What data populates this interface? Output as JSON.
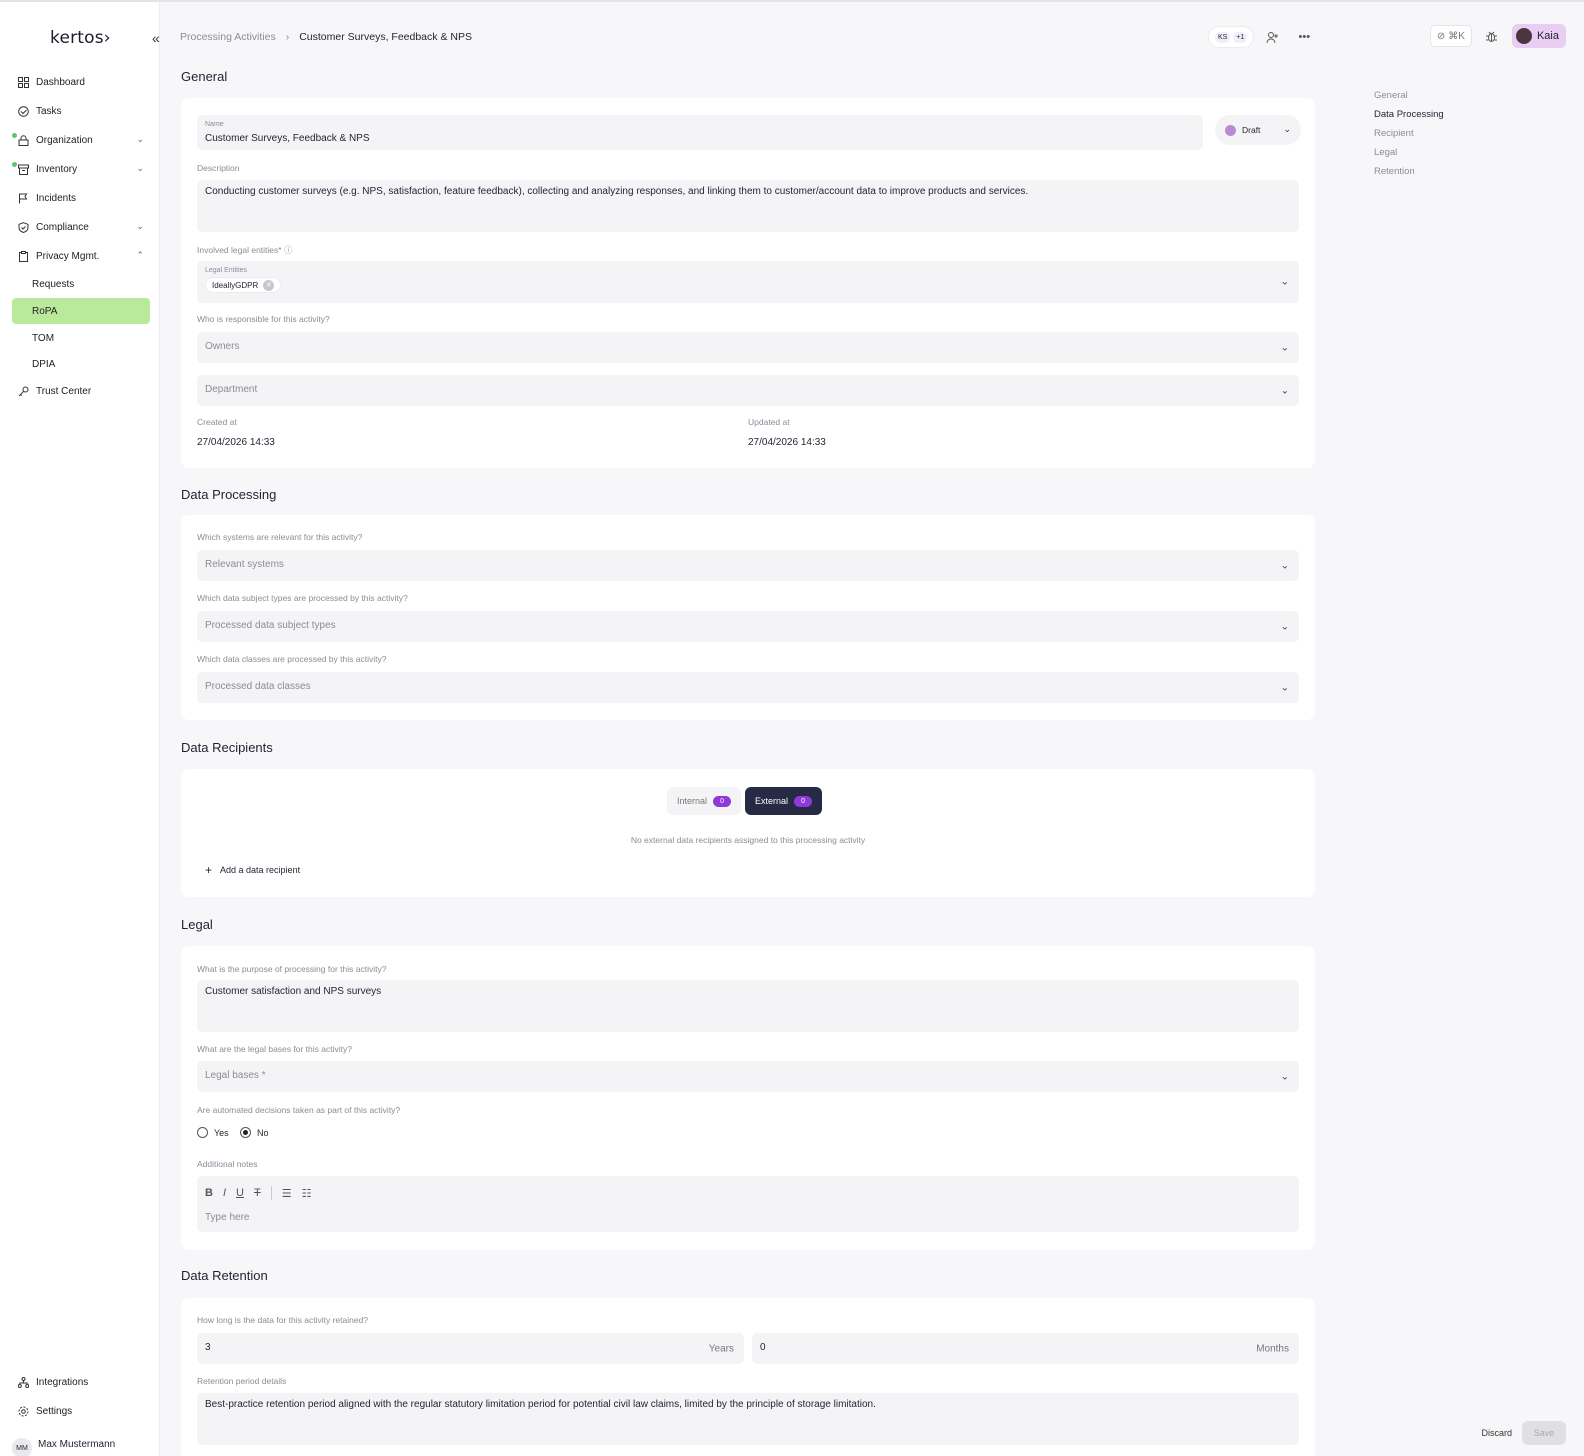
{
  "sidebar": {
    "logo": "kertos›",
    "collapse_icon": "«",
    "items": [
      {
        "label": "Dashboard",
        "icon": "grid-icon"
      },
      {
        "label": "Tasks",
        "icon": "check-circle-icon"
      },
      {
        "label": "Organization",
        "icon": "lock-icon"
      },
      {
        "label": "Inventory",
        "icon": "archive-icon"
      },
      {
        "label": "Incidents",
        "icon": "flag-icon"
      },
      {
        "label": "Compliance",
        "icon": "shield-icon"
      },
      {
        "label": "Privacy Mgmt.",
        "icon": "clipboard-icon"
      }
    ],
    "sub_items": [
      {
        "label": "Requests"
      },
      {
        "label": "RoPA"
      },
      {
        "label": "TOM"
      },
      {
        "label": "DPIA"
      }
    ],
    "trust_center": "Trust Center",
    "bottom": [
      {
        "label": "Integrations"
      },
      {
        "label": "Settings"
      }
    ],
    "user_initials": "MM",
    "user_name": "Max Mustermann",
    "accent": "#b9ea9c"
  },
  "topbar": {
    "breadcrumb_parent": "Processing Activities",
    "breadcrumb_current": "Customer Surveys, Feedback & NPS",
    "user_initials": "KS",
    "user_extra": "+1",
    "shortcut": "⌘K",
    "profile_name": "Kaia"
  },
  "toc": [
    "General",
    "Data Processing",
    "Recipient",
    "Legal",
    "Retention"
  ],
  "general": {
    "title": "General",
    "name_label": "Name",
    "name_value": "Customer Surveys, Feedback & NPS",
    "status": "Draft",
    "description_label": "Description",
    "description_value": "Conducting customer surveys (e.g. NPS, satisfaction, feature feedback), collecting and analyzing responses, and linking them to customer/account data to improve products and services.",
    "legal_entities_question": "Involved legal entities*",
    "legal_entities_label": "Legal Entities",
    "legal_entity_tag": "IdeallyGDPR",
    "responsible_question": "Who is responsible for this activity?",
    "owners_placeholder": "Owners",
    "department_placeholder": "Department",
    "created_label": "Created at",
    "created_value": "27/04/2026 14:33",
    "updated_label": "Updated at",
    "updated_value": "27/04/2026 14:33"
  },
  "processing": {
    "title": "Data Processing",
    "systems_question": "Which systems are relevant for this activity?",
    "systems_placeholder": "Relevant systems",
    "subjects_question": "Which data subject types are processed by this activity?",
    "subjects_placeholder": "Processed data subject types",
    "classes_question": "Which data classes are processed by this activity?",
    "classes_placeholder": "Processed data classes"
  },
  "recipients": {
    "title": "Data Recipients",
    "internal_label": "Internal",
    "internal_count": "0",
    "external_label": "External",
    "external_count": "0",
    "empty_text": "No external data recipients assigned to this processing activity",
    "add_label": "Add a data recipient"
  },
  "legal": {
    "title": "Legal",
    "purpose_question": "What is the purpose of processing for this activity?",
    "purpose_value": "Customer satisfaction and NPS surveys",
    "bases_question": "What are the legal bases for this activity?",
    "bases_placeholder": "Legal bases *",
    "automated_question": "Are automated decisions taken as part of this activity?",
    "yes_label": "Yes",
    "no_label": "No",
    "notes_label": "Additional notes",
    "notes_placeholder": "Type here"
  },
  "retention": {
    "title": "Data Retention",
    "question": "How long is the data for this activity retained?",
    "years_value": "3",
    "years_unit": "Years",
    "months_value": "0",
    "months_unit": "Months",
    "details_label": "Retention period details",
    "details_value": "Best-practice retention period aligned with the regular statutory limitation period for potential civil law claims, limited by the principle of storage limitation."
  },
  "footer": {
    "discard": "Discard",
    "save": "Save"
  }
}
